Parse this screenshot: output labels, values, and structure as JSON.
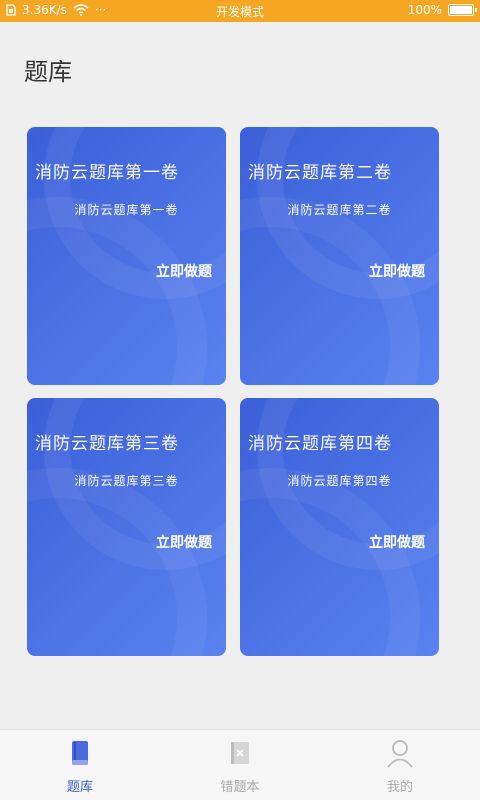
{
  "status_bar": {
    "speed": "3.36K/s",
    "dots": "···",
    "center_text": "开发模式",
    "battery_percent": "100%"
  },
  "page": {
    "title": "题库"
  },
  "cards": [
    {
      "title": "消防云题库第一卷",
      "subtitle": "消防云题库第一卷",
      "action": "立即做题"
    },
    {
      "title": "消防云题库第二卷",
      "subtitle": "消防云题库第二卷",
      "action": "立即做题"
    },
    {
      "title": "消防云题库第三卷",
      "subtitle": "消防云题库第三卷",
      "action": "立即做题"
    },
    {
      "title": "消防云题库第四卷",
      "subtitle": "消防云题库第四卷",
      "action": "立即做题"
    }
  ],
  "nav": {
    "items": [
      {
        "label": "题库",
        "icon": "book-icon",
        "active": true
      },
      {
        "label": "错题本",
        "icon": "wrong-notebook-icon",
        "active": false
      },
      {
        "label": "我的",
        "icon": "user-icon",
        "active": false
      }
    ]
  },
  "colors": {
    "status_bar": "#f5a623",
    "accent": "#3c5fd8",
    "card_gradient_start": "#3c5fd8",
    "card_gradient_end": "#5a82f0"
  }
}
